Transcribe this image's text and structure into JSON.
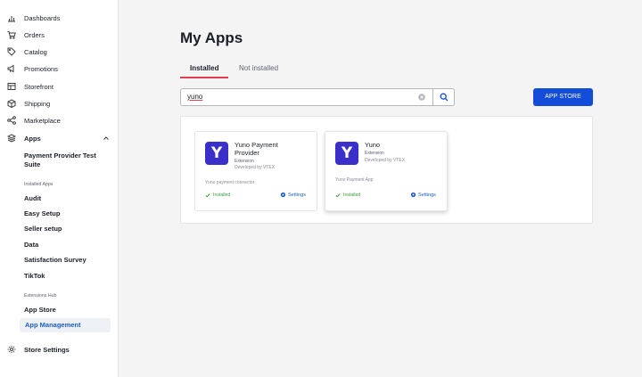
{
  "sidebar": {
    "items": [
      {
        "label": "Dashboards",
        "icon": "chart-icon"
      },
      {
        "label": "Orders",
        "icon": "cart-icon"
      },
      {
        "label": "Catalog",
        "icon": "tag-icon"
      },
      {
        "label": "Promotions",
        "icon": "megaphone-icon"
      },
      {
        "label": "Storefront",
        "icon": "layout-icon"
      },
      {
        "label": "Shipping",
        "icon": "box-icon"
      },
      {
        "label": "Marketplace",
        "icon": "network-icon"
      },
      {
        "label": "Apps",
        "icon": "layers-icon"
      }
    ],
    "apps_submenu": {
      "payment_provider": "Payment Provider Test Suite",
      "installed_apps_header": "Installed Apps",
      "installed_apps": [
        "Audit",
        "Easy Setup",
        "Seller setup",
        "Data",
        "Satisfaction Survey",
        "TikTok"
      ],
      "extensions_hub_header": "Extensions Hub",
      "extensions_hub": [
        "App Store",
        "App Management"
      ]
    },
    "store_settings": "Store Settings"
  },
  "main": {
    "title": "My Apps",
    "tabs": [
      {
        "label": "Installed",
        "active": true
      },
      {
        "label": "Not installed",
        "active": false
      }
    ],
    "search": {
      "value": "yuno"
    },
    "app_store_button": "APP STORE",
    "cards": [
      {
        "logo_letter": "Y",
        "name": "Yuno Payment Provider",
        "kind": "Extension",
        "developer": "Developed by VTEX",
        "description": "Yuno payment connector",
        "status": "Installed",
        "settings": "Settings"
      },
      {
        "logo_letter": "Y",
        "name": "Yuno",
        "kind": "Extension",
        "developer": "Developed by VTEX",
        "description": "Yuno Payment App",
        "status": "Installed",
        "settings": "Settings"
      }
    ]
  },
  "colors": {
    "primary": "#134cd8",
    "active_link": "#1a5ec5",
    "tab_underline": "#e13d52",
    "app_logo": "#3a30c9",
    "installed_green": "#3a9c3a"
  }
}
